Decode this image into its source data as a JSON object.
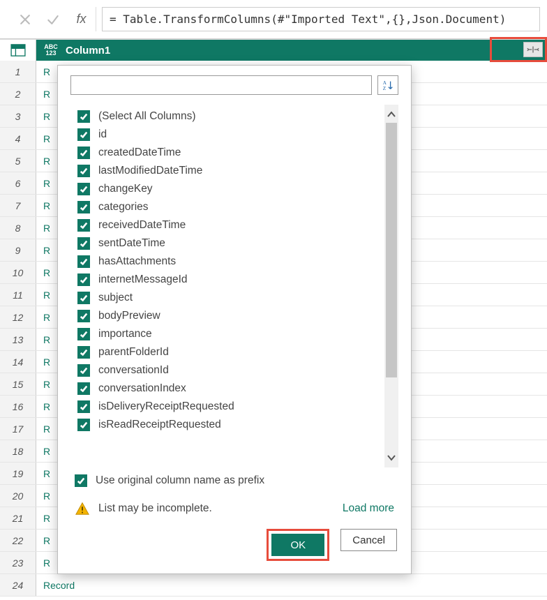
{
  "formula_bar": {
    "fx_label": "fx",
    "formula": "= Table.TransformColumns(#\"Imported Text\",{},Json.Document)"
  },
  "column_header": {
    "type_label_top": "ABC",
    "type_label_bottom": "123",
    "name": "Column1"
  },
  "rows": [
    {
      "n": "1",
      "v": "R"
    },
    {
      "n": "2",
      "v": "R"
    },
    {
      "n": "3",
      "v": "R"
    },
    {
      "n": "4",
      "v": "R"
    },
    {
      "n": "5",
      "v": "R"
    },
    {
      "n": "6",
      "v": "R"
    },
    {
      "n": "7",
      "v": "R"
    },
    {
      "n": "8",
      "v": "R"
    },
    {
      "n": "9",
      "v": "R"
    },
    {
      "n": "10",
      "v": "R"
    },
    {
      "n": "11",
      "v": "R"
    },
    {
      "n": "12",
      "v": "R"
    },
    {
      "n": "13",
      "v": "R"
    },
    {
      "n": "14",
      "v": "R"
    },
    {
      "n": "15",
      "v": "R"
    },
    {
      "n": "16",
      "v": "R"
    },
    {
      "n": "17",
      "v": "R"
    },
    {
      "n": "18",
      "v": "R"
    },
    {
      "n": "19",
      "v": "R"
    },
    {
      "n": "20",
      "v": "R"
    },
    {
      "n": "21",
      "v": "R"
    },
    {
      "n": "22",
      "v": "R"
    },
    {
      "n": "23",
      "v": "R"
    },
    {
      "n": "24",
      "v": "Record"
    }
  ],
  "popup": {
    "search_placeholder": "",
    "columns": [
      "(Select All Columns)",
      "id",
      "createdDateTime",
      "lastModifiedDateTime",
      "changeKey",
      "categories",
      "receivedDateTime",
      "sentDateTime",
      "hasAttachments",
      "internetMessageId",
      "subject",
      "bodyPreview",
      "importance",
      "parentFolderId",
      "conversationId",
      "conversationIndex",
      "isDeliveryReceiptRequested",
      "isReadReceiptRequested"
    ],
    "prefix_label": "Use original column name as prefix",
    "warning_text": "List may be incomplete.",
    "load_more_label": "Load more",
    "ok_label": "OK",
    "cancel_label": "Cancel"
  }
}
